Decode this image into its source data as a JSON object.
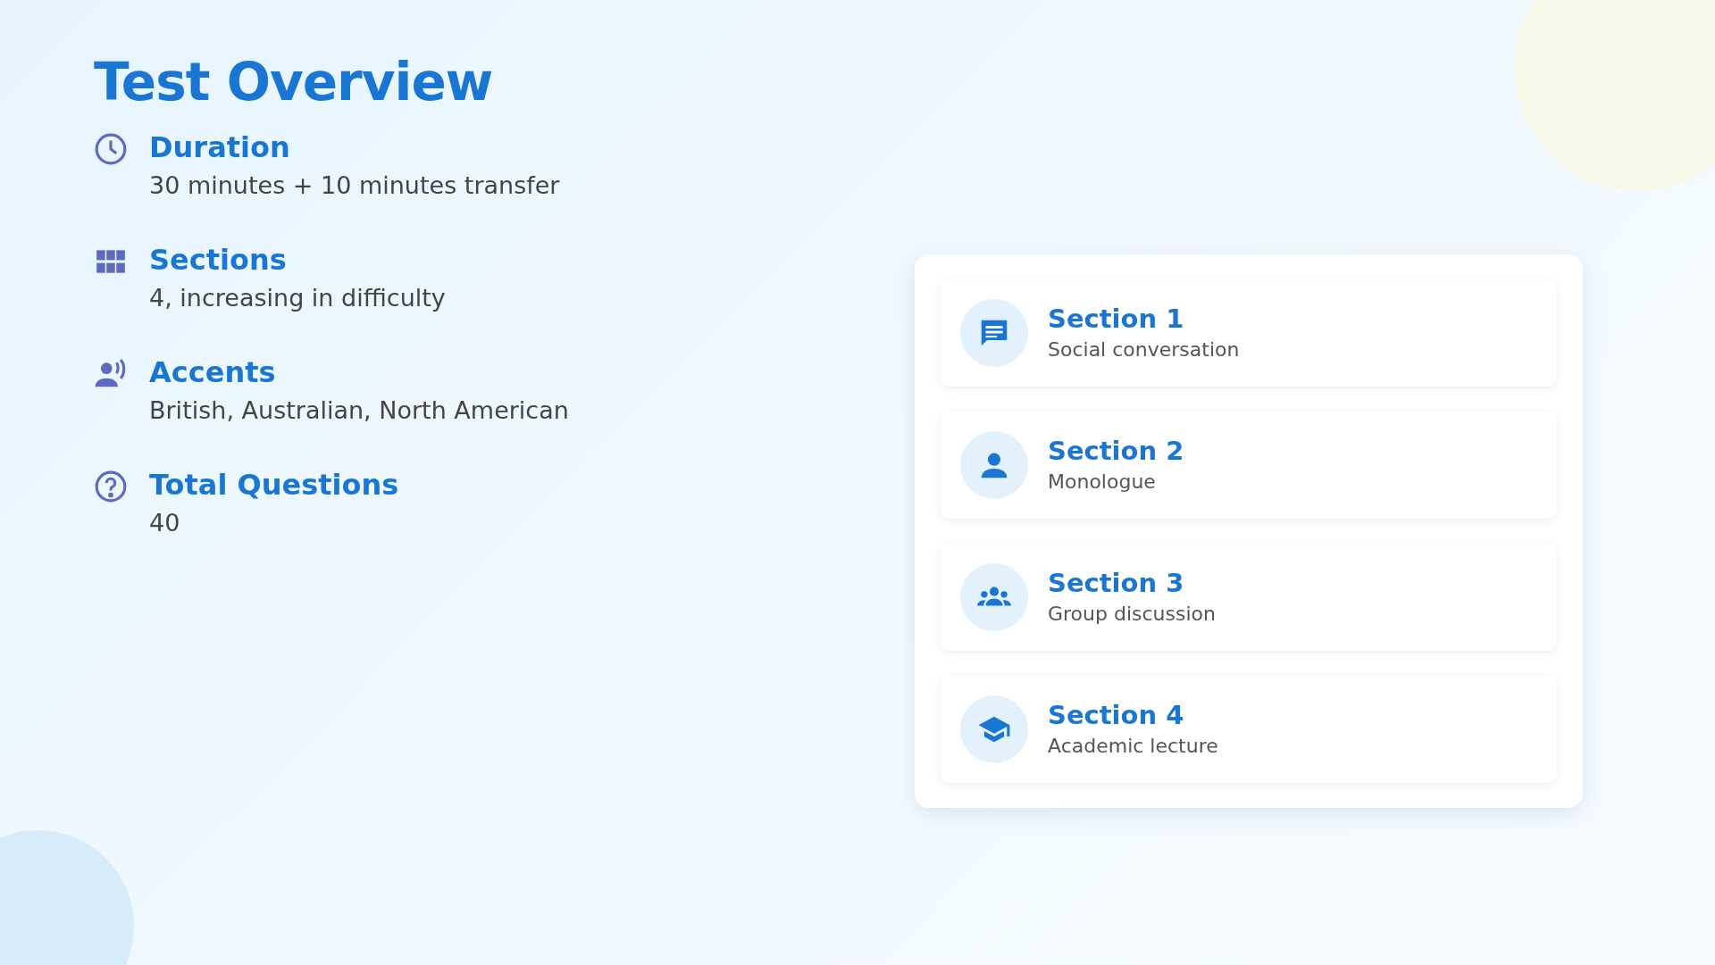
{
  "title": "Test Overview",
  "facts": [
    {
      "kind": "clock",
      "label": "Duration",
      "value": "30 minutes + 10 minutes transfer"
    },
    {
      "kind": "grid",
      "label": "Sections",
      "value": "4, increasing in difficulty"
    },
    {
      "kind": "speaker",
      "label": "Accents",
      "value": "British, Australian, North American"
    },
    {
      "kind": "question",
      "label": "Total Questions",
      "value": "40"
    }
  ],
  "sections": [
    {
      "kind": "chat",
      "title": "Section 1",
      "subtitle": "Social conversation"
    },
    {
      "kind": "person",
      "title": "Section 2",
      "subtitle": "Monologue"
    },
    {
      "kind": "group",
      "title": "Section 3",
      "subtitle": "Group discussion"
    },
    {
      "kind": "cap",
      "title": "Section 4",
      "subtitle": "Academic lecture"
    }
  ]
}
